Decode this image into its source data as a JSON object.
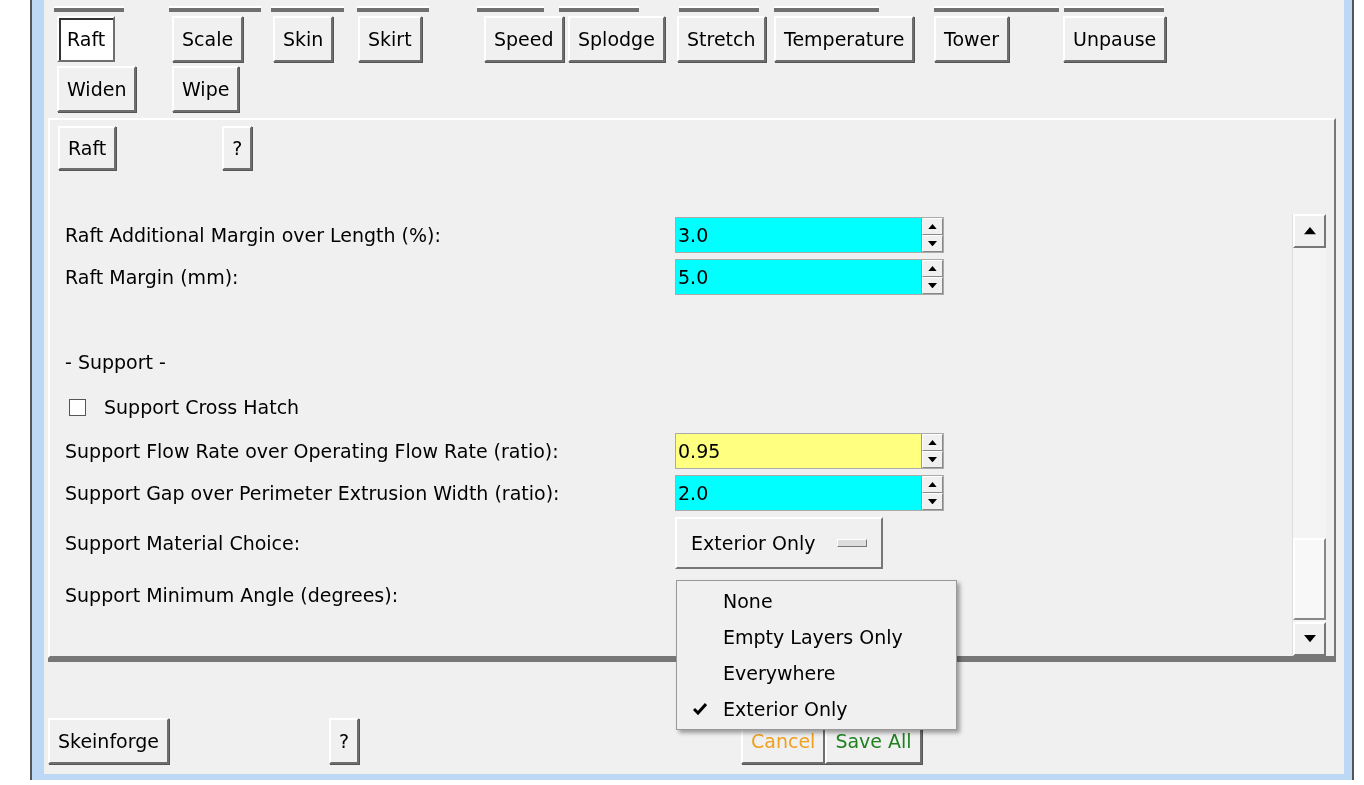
{
  "tabs": [
    {
      "label": "Raft",
      "selected": true
    },
    {
      "label": "Scale",
      "selected": false
    },
    {
      "label": "Skin",
      "selected": false
    },
    {
      "label": "Skirt",
      "selected": false
    },
    {
      "label": "Speed",
      "selected": false
    },
    {
      "label": "Splodge",
      "selected": false
    },
    {
      "label": "Stretch",
      "selected": false
    },
    {
      "label": "Temperature",
      "selected": false
    },
    {
      "label": "Tower",
      "selected": false
    },
    {
      "label": "Unpause",
      "selected": false
    },
    {
      "label": "Widen",
      "selected": false
    },
    {
      "label": "Wipe",
      "selected": false
    }
  ],
  "panel": {
    "title_button": "Raft",
    "help_button": "?",
    "rows": [
      {
        "kind": "spin",
        "label": "Raft Additional Margin over Length (%):",
        "value": "3.0",
        "color": "#00ffff"
      },
      {
        "kind": "spin",
        "label": "Raft Margin (mm):",
        "value": "5.0",
        "color": "#00ffff"
      },
      {
        "kind": "gap"
      },
      {
        "kind": "heading",
        "label": "- Support -"
      },
      {
        "kind": "check",
        "label": "Support Cross Hatch",
        "checked": false
      },
      {
        "kind": "spin",
        "label": "Support Flow Rate over Operating Flow Rate (ratio):",
        "value": "0.95",
        "color": "#ffff80"
      },
      {
        "kind": "spin",
        "label": "Support Gap over Perimeter Extrusion Width (ratio):",
        "value": "2.0",
        "color": "#00ffff"
      },
      {
        "kind": "menu",
        "label": "Support Material Choice:",
        "value": "Exterior Only"
      },
      {
        "kind": "label",
        "label": "Support Minimum Angle (degrees):"
      }
    ]
  },
  "footer": {
    "buttons": [
      {
        "label": "Skeinforge",
        "color": "#000000"
      },
      {
        "label": "?",
        "color": "#000000"
      },
      {
        "label": "Cancel",
        "color": "#f0a020"
      },
      {
        "label": "Save All",
        "color": "#208020"
      }
    ]
  },
  "dropdown": [
    {
      "label": "None",
      "selected": false
    },
    {
      "label": "Empty Layers Only",
      "selected": false
    },
    {
      "label": "Everywhere",
      "selected": false
    },
    {
      "label": "Exterior Only",
      "selected": true
    }
  ]
}
